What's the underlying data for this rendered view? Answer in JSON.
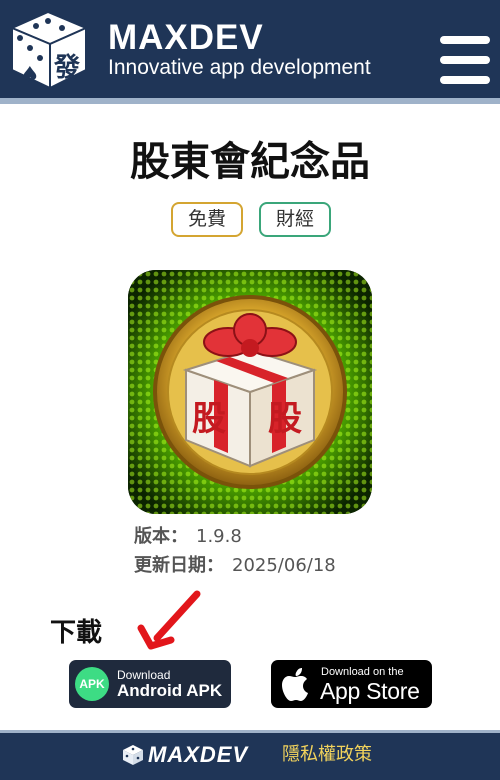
{
  "header": {
    "brand": "MAXDEV",
    "tagline": "Innovative app development",
    "logo_glyph": "發",
    "colors": {
      "bar": "#1f3557",
      "accent": "#9fb2c9"
    }
  },
  "app": {
    "title": "股東會紀念品",
    "tags": [
      "免費",
      "財經"
    ],
    "icon_name": "gift-box-icon",
    "icon_glyph": "股",
    "version_label": "版本：",
    "version": "1.9.8",
    "updated_label": "更新日期：",
    "updated": "2025/06/18"
  },
  "download": {
    "label": "下載",
    "apk": {
      "badge": "APK",
      "small": "Download",
      "big": "Android APK"
    },
    "ios": {
      "small": "Download on the",
      "big": "App Store"
    }
  },
  "footer": {
    "brand": "MAXDEV",
    "privacy_link": "隱私權政策"
  }
}
